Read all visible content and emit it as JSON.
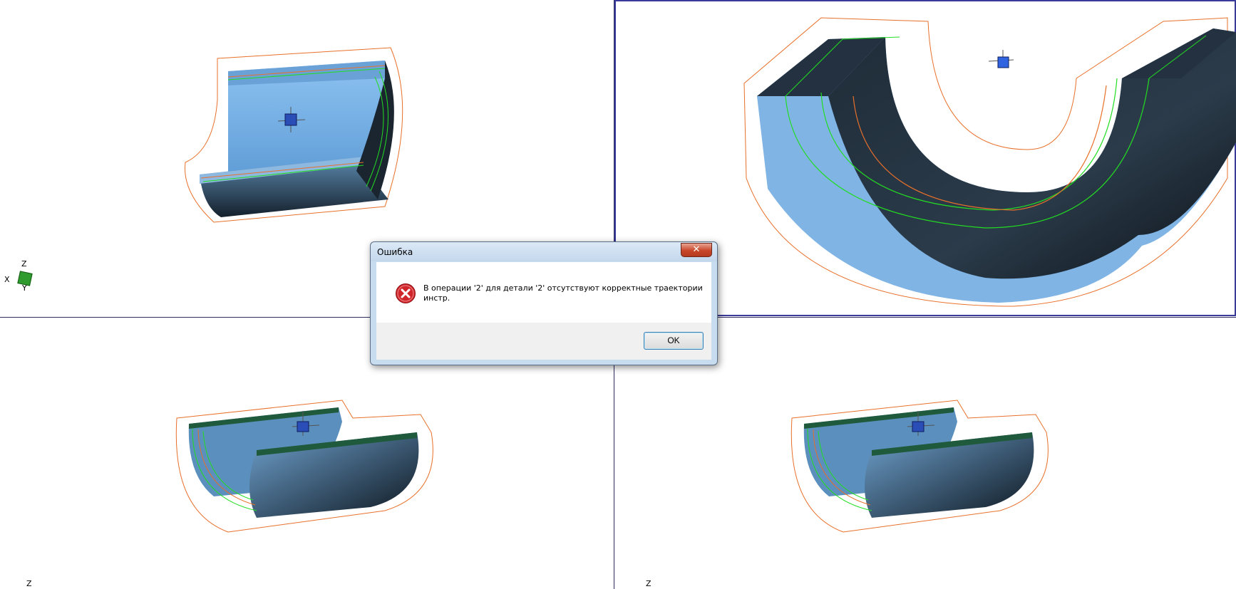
{
  "dialog": {
    "title": "Ошибка",
    "close_glyph": "✕",
    "icon": "error-icon",
    "message": "В операции '2' для детали '2' отсутствуют корректные траектории инстр.",
    "ok_label": "OK"
  },
  "viewports": {
    "top_left": {
      "axes": {
        "x": "X",
        "y": "Y",
        "z": "Z"
      }
    },
    "bottom_left": {
      "axis_label": "Z"
    },
    "bottom_right": {
      "axis_label": "Z"
    }
  },
  "colors": {
    "part_light": "#7fb4e4",
    "part_dark": "#1b2733",
    "toolpath_green": "#22dd22",
    "toolpath_orange": "#e8702a",
    "divider": "#2b2b5e",
    "error_red": "#d0262b"
  }
}
